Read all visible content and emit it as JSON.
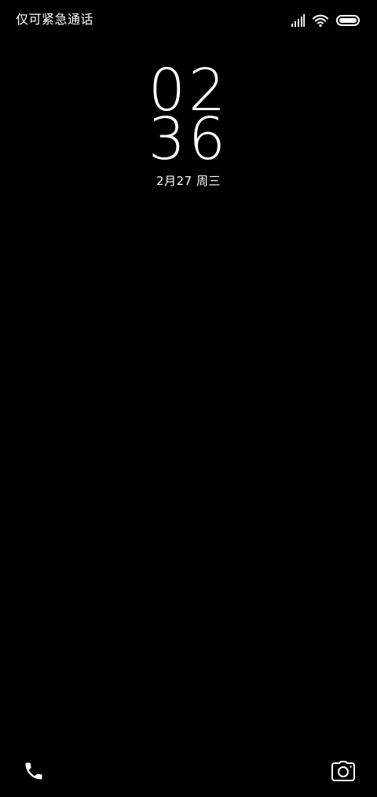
{
  "status_bar": {
    "carrier_text": "仅可紧急通话",
    "icons": [
      "signal-icon",
      "wifi-icon",
      "battery-icon"
    ]
  },
  "lock_screen": {
    "hour": "02",
    "minute": "36",
    "date": "2月27 周三"
  },
  "shortcuts": {
    "left": "phone-icon",
    "right": "camera-icon"
  },
  "colors": {
    "background": "#000000",
    "foreground": "#ffffff"
  }
}
